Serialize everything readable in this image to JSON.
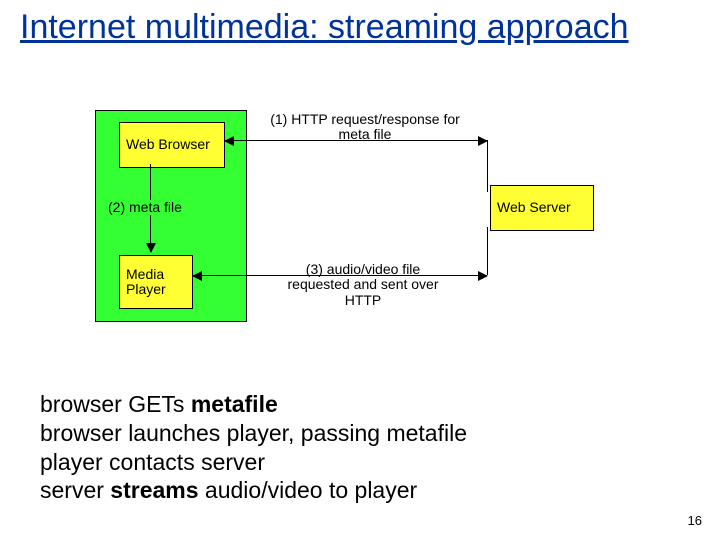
{
  "title": "Internet multimedia: streaming approach",
  "diagram": {
    "boxes": {
      "web_browser": "Web Browser",
      "media_player": "Media Player",
      "web_server": "Web Server"
    },
    "labels": {
      "step1": "(1) HTTP request/response for meta file",
      "step2": "(2)  meta file",
      "step3": "(3) audio/video file requested and sent over HTTP"
    }
  },
  "notes": {
    "l1a": "browser GETs ",
    "l1b": "metafile",
    "l2": "browser launches player, passing metafile",
    "l3": "player contacts server",
    "l4a": "server ",
    "l4b": "streams",
    "l4c": " audio/video to player"
  },
  "page": "16"
}
